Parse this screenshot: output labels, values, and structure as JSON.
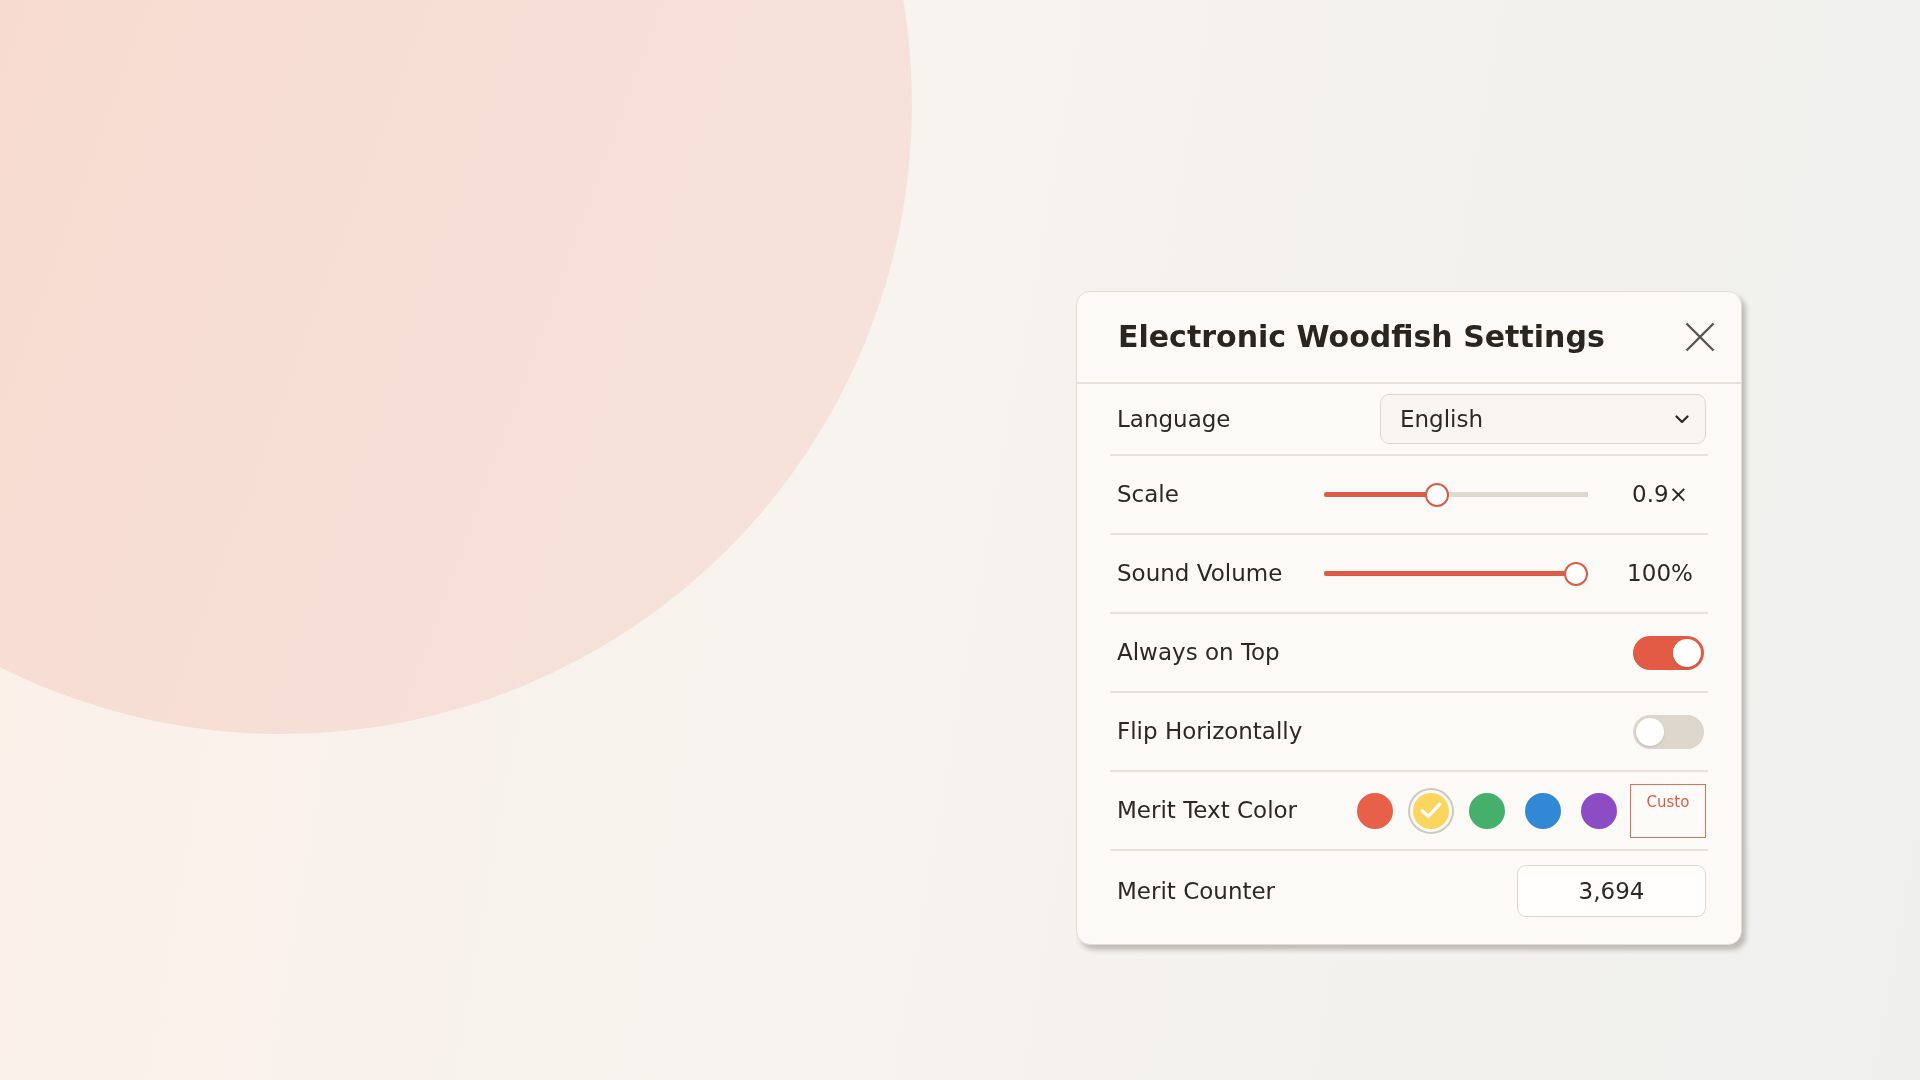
{
  "dialog": {
    "title": "Electronic Woodfish Settings"
  },
  "settings": [
    {
      "kind": "select",
      "label": "Language",
      "value": "English"
    },
    {
      "kind": "slider",
      "label": "Scale",
      "level": 0.42,
      "reading": "0.9×"
    },
    {
      "kind": "slider",
      "label": "Sound Volume",
      "level": 1,
      "reading": "100%"
    },
    {
      "kind": "toggle",
      "label": "Always on Top",
      "on": true
    },
    {
      "kind": "toggle",
      "label": "Flip Horizontally",
      "on": false
    },
    {
      "kind": "colors",
      "label": "Merit Text Color",
      "swatches": [
        {
          "color": "#e8604a",
          "selected": false
        },
        {
          "color": "#fbd55e",
          "selected": true
        },
        {
          "color": "#45b06b",
          "selected": false
        },
        {
          "color": "#3388d6",
          "selected": false
        },
        {
          "color": "#8c4cc4",
          "selected": false
        }
      ],
      "custom_button": "Custo"
    },
    {
      "kind": "number",
      "label": "Merit Counter",
      "value": "3,694"
    }
  ]
}
